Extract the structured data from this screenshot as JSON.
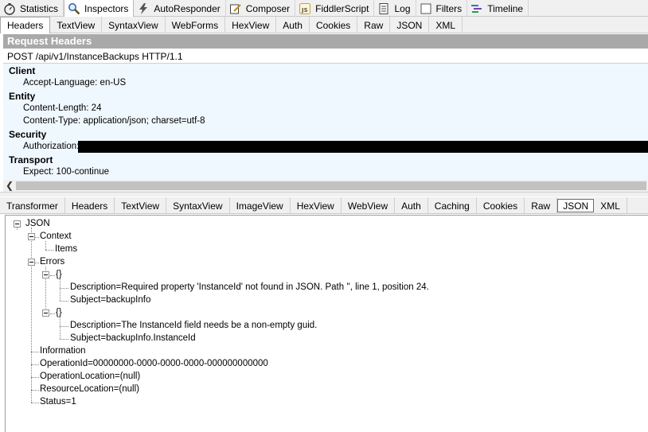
{
  "main_tabs": [
    {
      "label": "Statistics",
      "icon": "stopwatch-icon"
    },
    {
      "label": "Inspectors",
      "icon": "magnifier-icon",
      "active": true
    },
    {
      "label": "AutoResponder",
      "icon": "lightning-icon"
    },
    {
      "label": "Composer",
      "icon": "pencil-icon"
    },
    {
      "label": "FiddlerScript",
      "icon": "js-script-icon"
    },
    {
      "label": "Log",
      "icon": "log-icon"
    },
    {
      "label": "Filters",
      "icon": "checkbox-icon"
    },
    {
      "label": "Timeline",
      "icon": "timeline-icon"
    }
  ],
  "request_tabs": [
    "Headers",
    "TextView",
    "SyntaxView",
    "WebForms",
    "HexView",
    "Auth",
    "Cookies",
    "Raw",
    "JSON",
    "XML"
  ],
  "request": {
    "title": "Request Headers",
    "request_line": "POST /api/v1/InstanceBackups HTTP/1.1",
    "groups": [
      {
        "name": "Client",
        "headers": [
          "Accept-Language: en-US"
        ]
      },
      {
        "name": "Entity",
        "headers": [
          "Content-Length: 24",
          "Content-Type: application/json; charset=utf-8"
        ]
      },
      {
        "name": "Security",
        "headers": [
          "Authorization:"
        ]
      },
      {
        "name": "Transport",
        "headers": [
          "Expect: 100-continue"
        ]
      }
    ]
  },
  "response_tabs": [
    "Transformer",
    "Headers",
    "TextView",
    "SyntaxView",
    "ImageView",
    "HexView",
    "WebView",
    "Auth",
    "Caching",
    "Cookies",
    "Raw",
    "JSON",
    "XML"
  ],
  "tree": {
    "root": "JSON",
    "context": "Context",
    "items": "Items",
    "errors": "Errors",
    "obj1": "{}",
    "obj1_desc": "Description=Required property 'InstanceId' not found in JSON. Path '', line 1, position 24.",
    "obj1_subject": "Subject=backupInfo",
    "obj2": "{}",
    "obj2_desc": "Description=The InstanceId field needs be a non-empty guid.",
    "obj2_subject": "Subject=backupInfo.InstanceId",
    "information": "Information",
    "operation_id": "OperationId=00000000-0000-0000-0000-000000000000",
    "operation_location": "OperationLocation=(null)",
    "resource_location": "ResourceLocation=(null)",
    "status": "Status=1"
  }
}
